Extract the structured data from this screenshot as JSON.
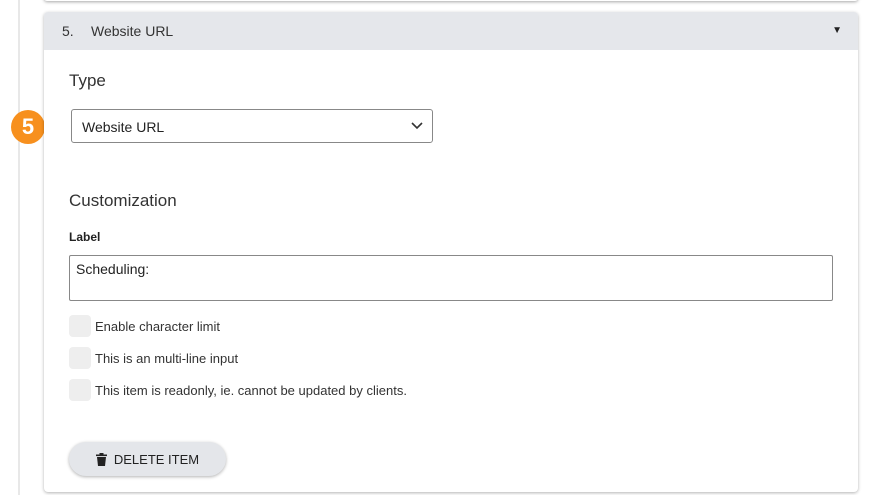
{
  "item": {
    "number": "5.",
    "title": "Website URL"
  },
  "step_badge": "5",
  "type_section": {
    "heading": "Type",
    "selected": "Website URL"
  },
  "customization": {
    "heading": "Customization",
    "label_caption": "Label",
    "label_value": "Scheduling:",
    "checkboxes": [
      {
        "label": "Enable character limit",
        "checked": false
      },
      {
        "label": "This is an multi-line input",
        "checked": false
      },
      {
        "label": "This item is readonly, ie. cannot be updated by clients.",
        "checked": false
      }
    ]
  },
  "delete_label": "DELETE ITEM"
}
